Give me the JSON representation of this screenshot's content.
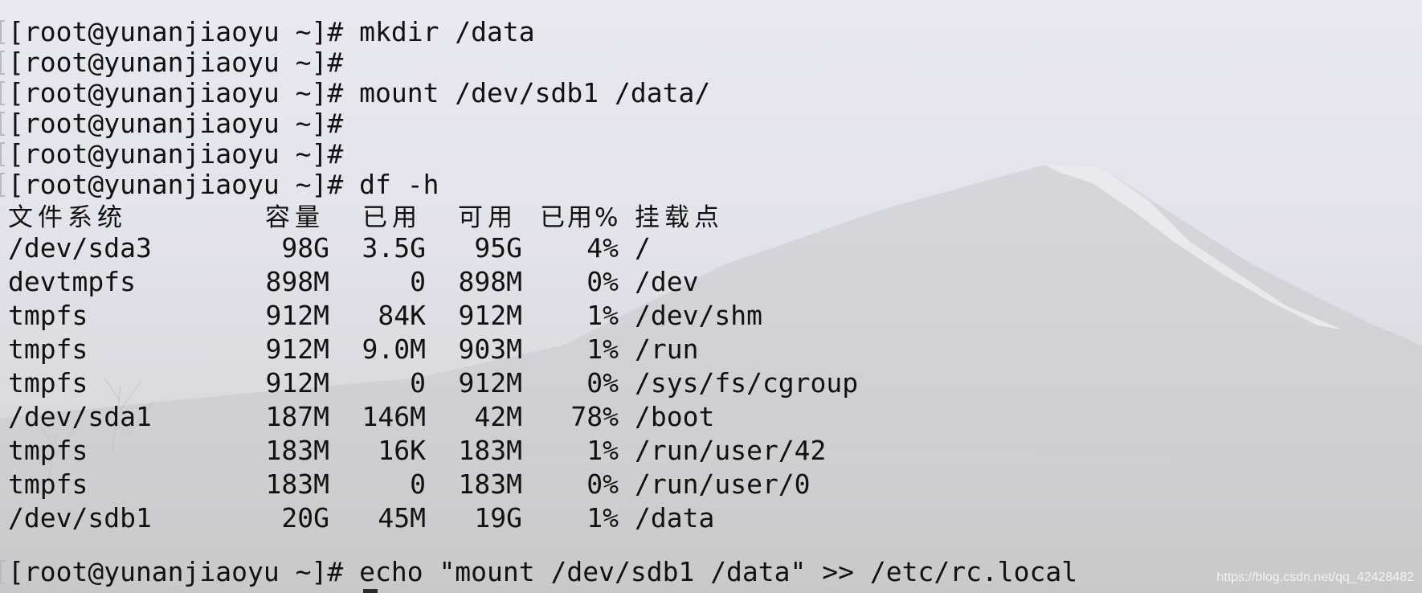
{
  "terminal": {
    "prompt": "[root@yunanjiaoyu ~]#",
    "history": [
      {
        "command": " mkdir /data"
      },
      {
        "command": ""
      },
      {
        "command": " mount /dev/sdb1 /data/"
      },
      {
        "command": ""
      },
      {
        "command": ""
      },
      {
        "command": " df -h"
      }
    ],
    "df_header": {
      "filesystem": "文件系统",
      "size": "容量",
      "used": "已用",
      "avail": "可用",
      "use_pct": "已用%",
      "mounted_on": "挂载点"
    },
    "df_rows": [
      {
        "filesystem": "/dev/sda3",
        "size": "98G",
        "used": "3.5G",
        "avail": "95G",
        "use_pct": "4%",
        "mounted_on": "/"
      },
      {
        "filesystem": "devtmpfs",
        "size": "898M",
        "used": "0",
        "avail": "898M",
        "use_pct": "0%",
        "mounted_on": "/dev"
      },
      {
        "filesystem": "tmpfs",
        "size": "912M",
        "used": "84K",
        "avail": "912M",
        "use_pct": "1%",
        "mounted_on": "/dev/shm"
      },
      {
        "filesystem": "tmpfs",
        "size": "912M",
        "used": "9.0M",
        "avail": "903M",
        "use_pct": "1%",
        "mounted_on": "/run"
      },
      {
        "filesystem": "tmpfs",
        "size": "912M",
        "used": "0",
        "avail": "912M",
        "use_pct": "0%",
        "mounted_on": "/sys/fs/cgroup"
      },
      {
        "filesystem": "/dev/sda1",
        "size": "187M",
        "used": "146M",
        "avail": "42M",
        "use_pct": "78%",
        "mounted_on": "/boot"
      },
      {
        "filesystem": "tmpfs",
        "size": "183M",
        "used": "16K",
        "avail": "183M",
        "use_pct": "1%",
        "mounted_on": "/run/user/42"
      },
      {
        "filesystem": "tmpfs",
        "size": "183M",
        "used": "0",
        "avail": "183M",
        "use_pct": "0%",
        "mounted_on": "/run/user/0"
      },
      {
        "filesystem": "/dev/sdb1",
        "size": "20G",
        "used": "45M",
        "avail": "19G",
        "use_pct": "1%",
        "mounted_on": "/data"
      }
    ],
    "last_command": " echo \"mount /dev/sdb1 /data\" >> /etc/rc.local"
  },
  "watermark": "https://blog.csdn.net/qq_42428482",
  "colors": {
    "text": "#111111",
    "background": "#e3e4eb"
  }
}
